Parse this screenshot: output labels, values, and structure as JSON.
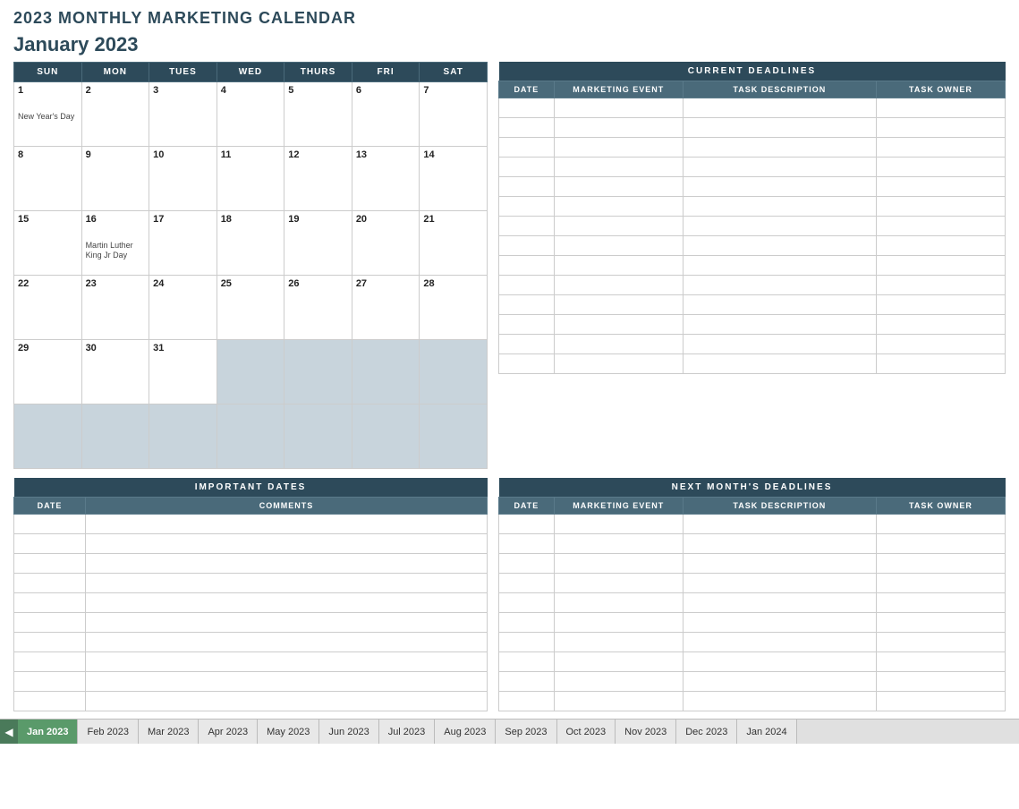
{
  "page": {
    "title": "2023 MONTHLY MARKETING CALENDAR",
    "month_title": "January 2023"
  },
  "calendar": {
    "days_of_week": [
      "SUN",
      "MON",
      "TUES",
      "WED",
      "THURS",
      "FRI",
      "SAT"
    ],
    "weeks": [
      [
        {
          "num": "1",
          "holiday": "New Year's Day",
          "inactive": false
        },
        {
          "num": "2",
          "holiday": "",
          "inactive": false
        },
        {
          "num": "3",
          "holiday": "",
          "inactive": false
        },
        {
          "num": "4",
          "holiday": "",
          "inactive": false
        },
        {
          "num": "5",
          "holiday": "",
          "inactive": false
        },
        {
          "num": "6",
          "holiday": "",
          "inactive": false
        },
        {
          "num": "7",
          "holiday": "",
          "inactive": false
        }
      ],
      [
        {
          "num": "8",
          "holiday": "",
          "inactive": false
        },
        {
          "num": "9",
          "holiday": "",
          "inactive": false
        },
        {
          "num": "10",
          "holiday": "",
          "inactive": false
        },
        {
          "num": "11",
          "holiday": "",
          "inactive": false
        },
        {
          "num": "12",
          "holiday": "",
          "inactive": false
        },
        {
          "num": "13",
          "holiday": "",
          "inactive": false
        },
        {
          "num": "14",
          "holiday": "",
          "inactive": false
        }
      ],
      [
        {
          "num": "15",
          "holiday": "",
          "inactive": false
        },
        {
          "num": "16",
          "holiday": "Martin Luther King Jr Day",
          "inactive": false
        },
        {
          "num": "17",
          "holiday": "",
          "inactive": false
        },
        {
          "num": "18",
          "holiday": "",
          "inactive": false
        },
        {
          "num": "19",
          "holiday": "",
          "inactive": false
        },
        {
          "num": "20",
          "holiday": "",
          "inactive": false
        },
        {
          "num": "21",
          "holiday": "",
          "inactive": false
        }
      ],
      [
        {
          "num": "22",
          "holiday": "",
          "inactive": false
        },
        {
          "num": "23",
          "holiday": "",
          "inactive": false
        },
        {
          "num": "24",
          "holiday": "",
          "inactive": false
        },
        {
          "num": "25",
          "holiday": "",
          "inactive": false
        },
        {
          "num": "26",
          "holiday": "",
          "inactive": false
        },
        {
          "num": "27",
          "holiday": "",
          "inactive": false
        },
        {
          "num": "28",
          "holiday": "",
          "inactive": false
        }
      ],
      [
        {
          "num": "29",
          "holiday": "",
          "inactive": false
        },
        {
          "num": "30",
          "holiday": "",
          "inactive": false
        },
        {
          "num": "31",
          "holiday": "",
          "inactive": false
        },
        {
          "num": "",
          "holiday": "",
          "inactive": true
        },
        {
          "num": "",
          "holiday": "",
          "inactive": true
        },
        {
          "num": "",
          "holiday": "",
          "inactive": true
        },
        {
          "num": "",
          "holiday": "",
          "inactive": true
        }
      ],
      [
        {
          "num": "",
          "holiday": "",
          "inactive": true
        },
        {
          "num": "",
          "holiday": "",
          "inactive": true
        },
        {
          "num": "",
          "holiday": "",
          "inactive": true
        },
        {
          "num": "",
          "holiday": "",
          "inactive": true
        },
        {
          "num": "",
          "holiday": "",
          "inactive": true
        },
        {
          "num": "",
          "holiday": "",
          "inactive": true
        },
        {
          "num": "",
          "holiday": "",
          "inactive": true
        }
      ]
    ]
  },
  "current_deadlines": {
    "title": "CURRENT DEADLINES",
    "headers": [
      "DATE",
      "MARKETING EVENT",
      "TASK DESCRIPTION",
      "TASK OWNER"
    ],
    "rows": 14
  },
  "important_dates": {
    "title": "IMPORTANT DATES",
    "headers": [
      "DATE",
      "COMMENTS"
    ],
    "rows": 10
  },
  "next_month_deadlines": {
    "title": "NEXT MONTH'S DEADLINES",
    "headers": [
      "DATE",
      "MARKETING EVENT",
      "TASK DESCRIPTION",
      "TASK OWNER"
    ],
    "rows": 10
  },
  "tabs": [
    {
      "label": "Jan 2023",
      "active": true
    },
    {
      "label": "Feb 2023",
      "active": false
    },
    {
      "label": "Mar 2023",
      "active": false
    },
    {
      "label": "Apr 2023",
      "active": false
    },
    {
      "label": "May 2023",
      "active": false
    },
    {
      "label": "Jun 2023",
      "active": false
    },
    {
      "label": "Jul 2023",
      "active": false
    },
    {
      "label": "Aug 2023",
      "active": false
    },
    {
      "label": "Sep 2023",
      "active": false
    },
    {
      "label": "Oct 2023",
      "active": false
    },
    {
      "label": "Nov 2023",
      "active": false
    },
    {
      "label": "Dec 2023",
      "active": false
    },
    {
      "label": "Jan 2024",
      "active": false
    }
  ]
}
